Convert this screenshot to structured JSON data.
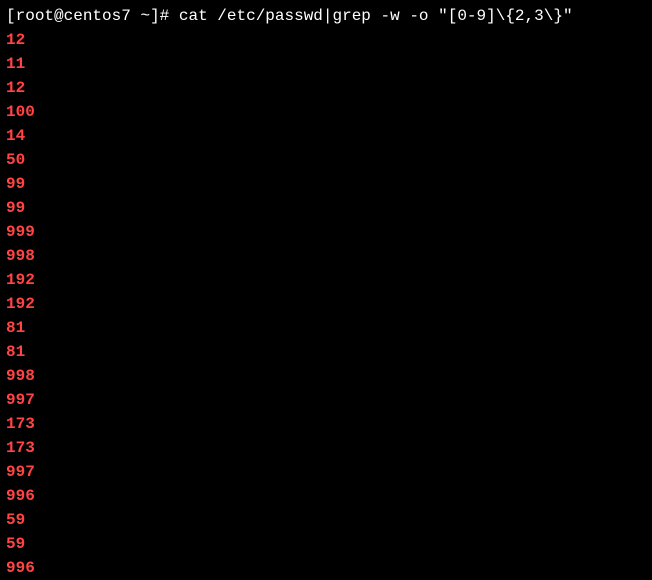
{
  "prompt": {
    "open_bracket": "[",
    "user": "root",
    "at": "@",
    "host": "centos7",
    "space": " ",
    "path": "~",
    "close_bracket": "]",
    "symbol": "# "
  },
  "command": "cat /etc/passwd|grep -w -o \"[0-9]\\{2,3\\}\"",
  "output": [
    "12",
    "11",
    "12",
    "100",
    "14",
    "50",
    "99",
    "99",
    "999",
    "998",
    "192",
    "192",
    "81",
    "81",
    "998",
    "997",
    "173",
    "173",
    "997",
    "996",
    "59",
    "59",
    "996"
  ]
}
